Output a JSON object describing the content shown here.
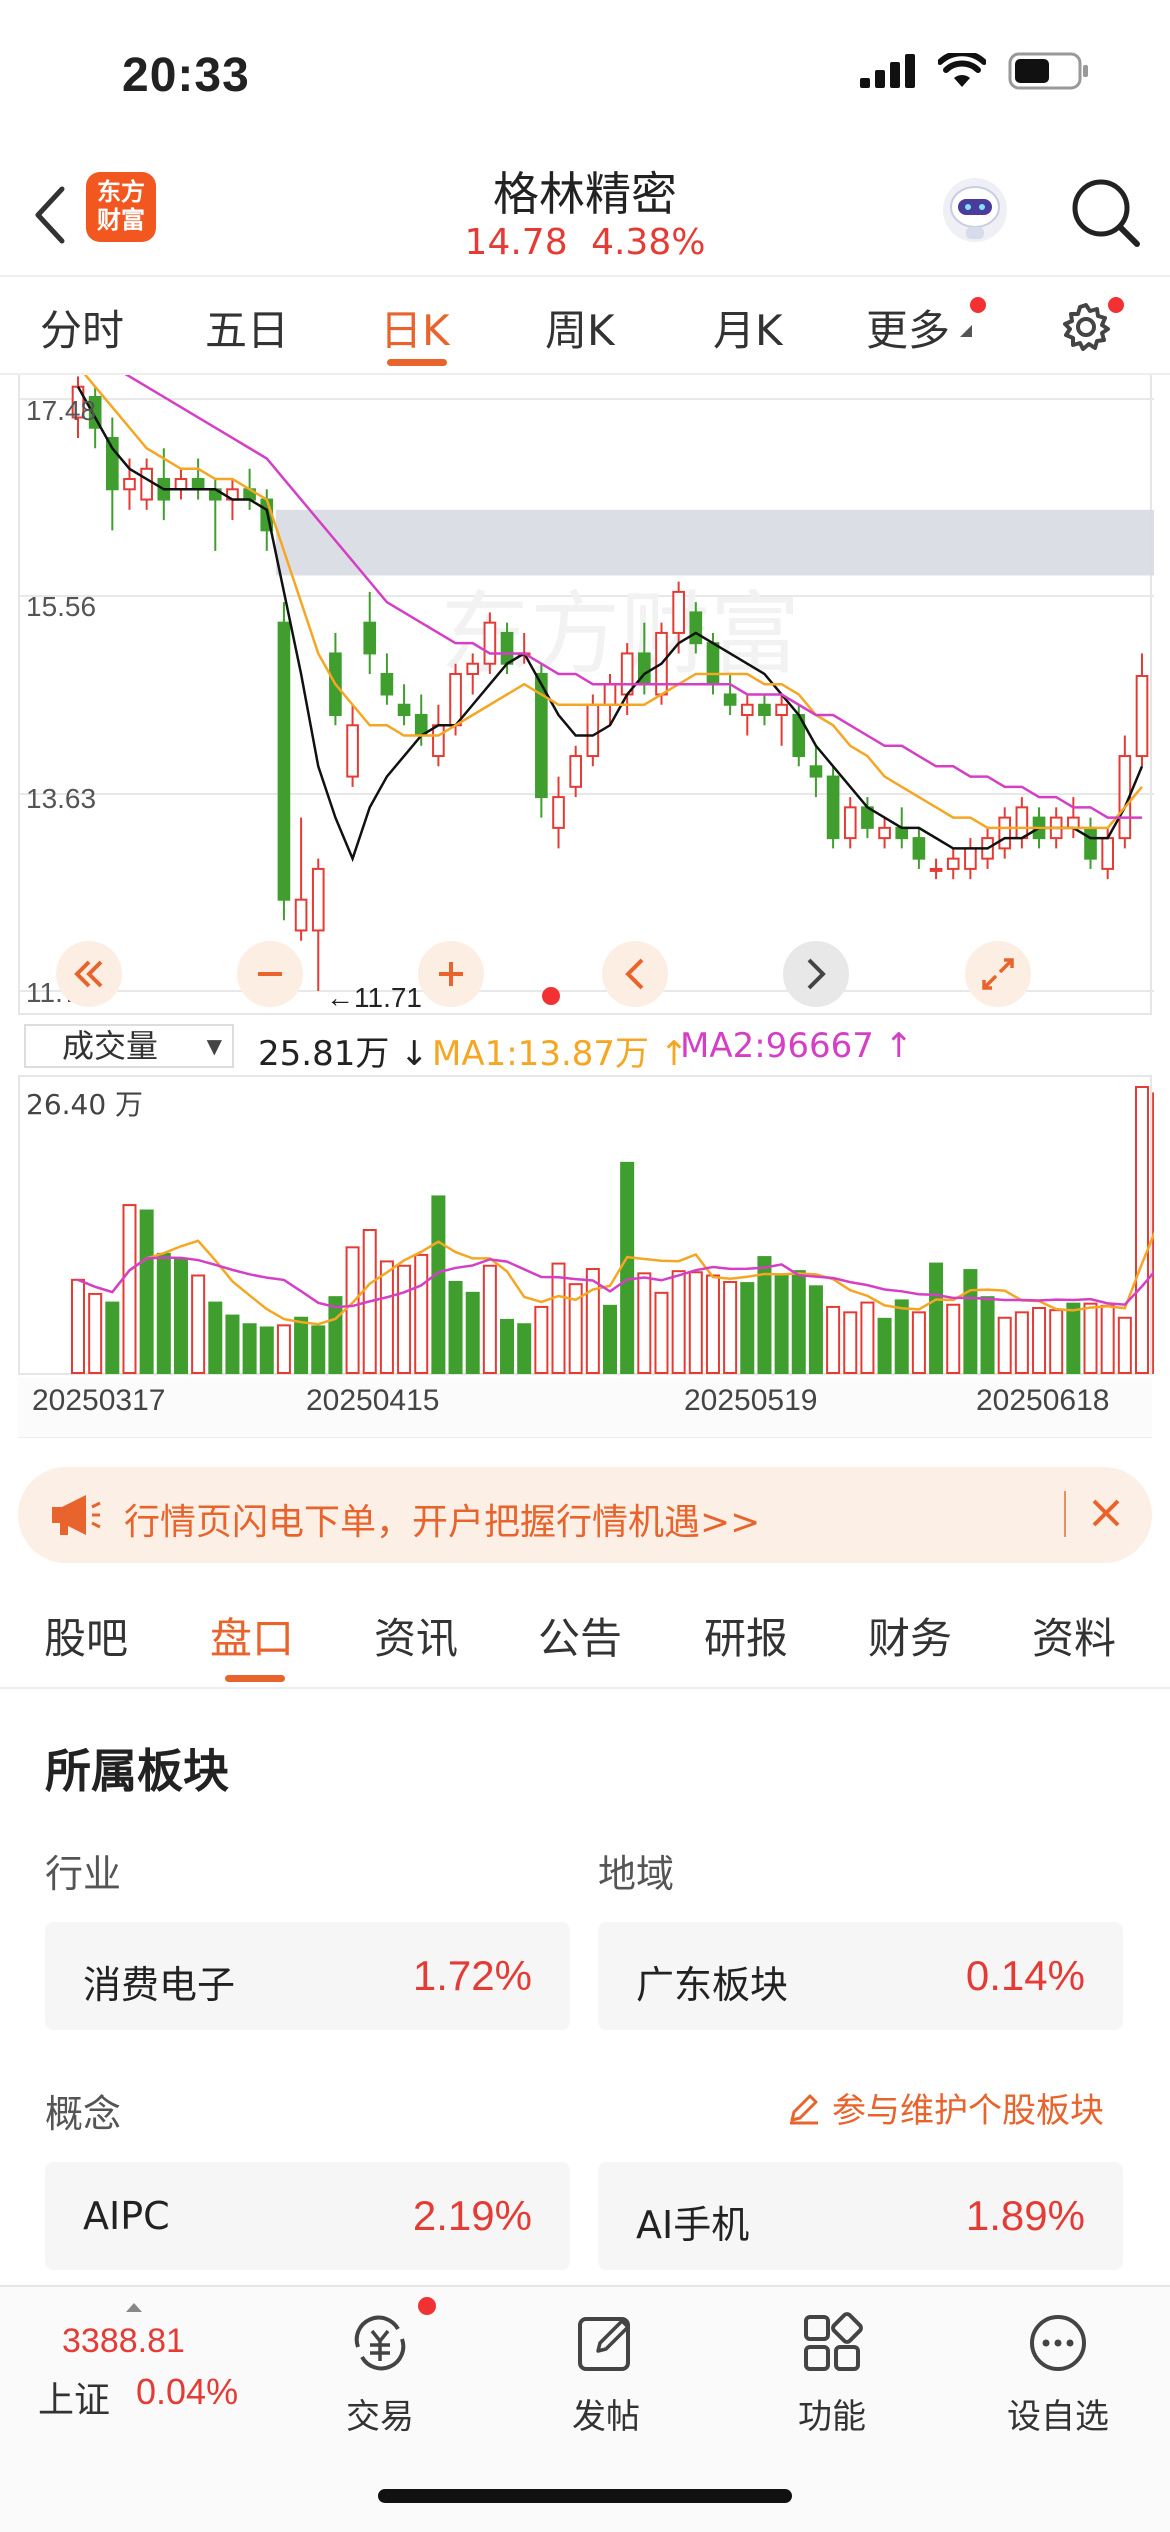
{
  "status_bar": {
    "time": "20:33"
  },
  "header": {
    "brand_logo_text": "东方\n财富",
    "title": "格林精密",
    "price": "14.78",
    "change_pct": "4.38%"
  },
  "period_tabs": [
    {
      "label": "分时"
    },
    {
      "label": "五日"
    },
    {
      "label": "日K"
    },
    {
      "label": "周K"
    },
    {
      "label": "月K"
    },
    {
      "label": "更多"
    }
  ],
  "active_period": "日K",
  "kline": {
    "price_axis": [
      "17.48",
      "15.56",
      "13.63",
      "11.71"
    ],
    "low_marker": "←11.71",
    "watermark": "东方财富"
  },
  "volume": {
    "selector": "成交量",
    "current": "25.81万 ↓",
    "ma1": "MA1:13.87万 ↑",
    "ma2": "MA2:96667 ↑",
    "max_label": "26.40 万",
    "dates": [
      "20250317",
      "20250415",
      "20250519",
      "20250618"
    ]
  },
  "chart_data": {
    "type": "candlestick",
    "title": "",
    "ylim": [
      11.71,
      17.48
    ],
    "y_ticks": [
      17.48,
      15.56,
      13.63,
      11.71
    ],
    "x_ticks": [
      "20250317",
      "20250415",
      "20250519",
      "20250618"
    ],
    "candles": [
      {
        "o": 17.3,
        "h": 17.7,
        "l": 17.1,
        "c": 17.6
      },
      {
        "o": 17.5,
        "h": 17.6,
        "l": 17.0,
        "c": 17.2
      },
      {
        "o": 17.1,
        "h": 17.3,
        "l": 16.2,
        "c": 16.6
      },
      {
        "o": 16.6,
        "h": 16.9,
        "l": 16.4,
        "c": 16.7
      },
      {
        "o": 16.5,
        "h": 16.9,
        "l": 16.4,
        "c": 16.8
      },
      {
        "o": 16.7,
        "h": 17.0,
        "l": 16.3,
        "c": 16.5
      },
      {
        "o": 16.6,
        "h": 16.8,
        "l": 16.5,
        "c": 16.7
      },
      {
        "o": 16.7,
        "h": 16.9,
        "l": 16.5,
        "c": 16.6
      },
      {
        "o": 16.6,
        "h": 16.7,
        "l": 16.0,
        "c": 16.5
      },
      {
        "o": 16.5,
        "h": 16.7,
        "l": 16.3,
        "c": 16.6
      },
      {
        "o": 16.6,
        "h": 16.8,
        "l": 16.4,
        "c": 16.5
      },
      {
        "o": 16.5,
        "h": 16.6,
        "l": 16.0,
        "c": 16.2
      },
      {
        "o": 15.3,
        "h": 15.5,
        "l": 12.4,
        "c": 12.6
      },
      {
        "o": 12.3,
        "h": 13.4,
        "l": 12.2,
        "c": 12.6
      },
      {
        "o": 12.3,
        "h": 13.0,
        "l": 11.71,
        "c": 12.9
      },
      {
        "o": 15.0,
        "h": 15.2,
        "l": 14.3,
        "c": 14.4
      },
      {
        "o": 13.8,
        "h": 14.5,
        "l": 13.7,
        "c": 14.3
      },
      {
        "o": 15.3,
        "h": 15.6,
        "l": 14.8,
        "c": 15.0
      },
      {
        "o": 14.8,
        "h": 15.0,
        "l": 14.5,
        "c": 14.6
      },
      {
        "o": 14.5,
        "h": 14.7,
        "l": 14.3,
        "c": 14.4
      },
      {
        "o": 14.4,
        "h": 14.6,
        "l": 14.1,
        "c": 14.2
      },
      {
        "o": 14.0,
        "h": 14.5,
        "l": 13.9,
        "c": 14.3
      },
      {
        "o": 14.3,
        "h": 14.9,
        "l": 14.2,
        "c": 14.8
      },
      {
        "o": 14.8,
        "h": 15.0,
        "l": 14.6,
        "c": 14.9
      },
      {
        "o": 14.9,
        "h": 15.4,
        "l": 14.8,
        "c": 15.3
      },
      {
        "o": 15.2,
        "h": 15.3,
        "l": 14.8,
        "c": 14.9
      },
      {
        "o": 15.0,
        "h": 15.2,
        "l": 14.9,
        "c": 15.0
      },
      {
        "o": 14.8,
        "h": 14.9,
        "l": 13.4,
        "c": 13.6
      },
      {
        "o": 13.3,
        "h": 13.8,
        "l": 13.1,
        "c": 13.6
      },
      {
        "o": 13.7,
        "h": 14.1,
        "l": 13.6,
        "c": 14.0
      },
      {
        "o": 14.0,
        "h": 14.6,
        "l": 13.9,
        "c": 14.5
      },
      {
        "o": 14.5,
        "h": 14.8,
        "l": 14.3,
        "c": 14.7
      },
      {
        "o": 14.6,
        "h": 15.1,
        "l": 14.4,
        "c": 15.0
      },
      {
        "o": 15.0,
        "h": 15.3,
        "l": 14.6,
        "c": 14.7
      },
      {
        "o": 14.6,
        "h": 15.3,
        "l": 14.5,
        "c": 15.2
      },
      {
        "o": 15.2,
        "h": 15.7,
        "l": 15.0,
        "c": 15.6
      },
      {
        "o": 15.4,
        "h": 15.5,
        "l": 15.0,
        "c": 15.1
      },
      {
        "o": 15.1,
        "h": 15.2,
        "l": 14.6,
        "c": 14.7
      },
      {
        "o": 14.6,
        "h": 14.8,
        "l": 14.4,
        "c": 14.5
      },
      {
        "o": 14.4,
        "h": 14.6,
        "l": 14.2,
        "c": 14.5
      },
      {
        "o": 14.5,
        "h": 14.6,
        "l": 14.3,
        "c": 14.4
      },
      {
        "o": 14.4,
        "h": 14.6,
        "l": 14.1,
        "c": 14.5
      },
      {
        "o": 14.4,
        "h": 14.5,
        "l": 13.9,
        "c": 14.0
      },
      {
        "o": 13.9,
        "h": 14.1,
        "l": 13.6,
        "c": 13.8
      },
      {
        "o": 13.8,
        "h": 13.9,
        "l": 13.1,
        "c": 13.2
      },
      {
        "o": 13.2,
        "h": 13.6,
        "l": 13.1,
        "c": 13.5
      },
      {
        "o": 13.5,
        "h": 13.6,
        "l": 13.2,
        "c": 13.3
      },
      {
        "o": 13.2,
        "h": 13.4,
        "l": 13.1,
        "c": 13.3
      },
      {
        "o": 13.3,
        "h": 13.5,
        "l": 13.1,
        "c": 13.2
      },
      {
        "o": 13.2,
        "h": 13.3,
        "l": 12.9,
        "c": 13.0
      },
      {
        "o": 12.9,
        "h": 13.0,
        "l": 12.8,
        "c": 12.9
      },
      {
        "o": 12.9,
        "h": 13.1,
        "l": 12.8,
        "c": 13.0
      },
      {
        "o": 12.9,
        "h": 13.2,
        "l": 12.8,
        "c": 13.1
      },
      {
        "o": 13.0,
        "h": 13.3,
        "l": 12.9,
        "c": 13.2
      },
      {
        "o": 13.1,
        "h": 13.5,
        "l": 13.0,
        "c": 13.4
      },
      {
        "o": 13.2,
        "h": 13.6,
        "l": 13.1,
        "c": 13.5
      },
      {
        "o": 13.4,
        "h": 13.5,
        "l": 13.1,
        "c": 13.2
      },
      {
        "o": 13.2,
        "h": 13.5,
        "l": 13.1,
        "c": 13.4
      },
      {
        "o": 13.3,
        "h": 13.6,
        "l": 13.2,
        "c": 13.4
      },
      {
        "o": 13.3,
        "h": 13.4,
        "l": 12.9,
        "c": 13.0
      },
      {
        "o": 12.9,
        "h": 13.3,
        "l": 12.8,
        "c": 13.2
      },
      {
        "o": 13.2,
        "h": 14.2,
        "l": 13.1,
        "c": 14.0
      },
      {
        "o": 14.0,
        "h": 15.0,
        "l": 13.9,
        "c": 14.78
      }
    ],
    "ma_lines": [
      {
        "color": "#111111",
        "values": [
          17.6,
          17.3,
          17.0,
          16.8,
          16.7,
          16.6,
          16.6,
          16.6,
          16.6,
          16.5,
          16.5,
          16.4,
          15.6,
          14.8,
          13.9,
          13.4,
          13.0,
          13.5,
          13.8,
          14.0,
          14.2,
          14.3,
          14.3,
          14.5,
          14.7,
          14.9,
          15.0,
          14.7,
          14.4,
          14.2,
          14.2,
          14.3,
          14.6,
          14.8,
          14.9,
          15.1,
          15.2,
          15.1,
          15.0,
          14.9,
          14.8,
          14.6,
          14.4,
          14.1,
          13.9,
          13.7,
          13.5,
          13.4,
          13.3,
          13.3,
          13.2,
          13.1,
          13.1,
          13.1,
          13.2,
          13.2,
          13.3,
          13.3,
          13.3,
          13.2,
          13.2,
          13.5,
          13.9
        ]
      },
      {
        "color": "#f5a623",
        "values": [
          17.8,
          17.6,
          17.4,
          17.2,
          17.0,
          16.9,
          16.8,
          16.8,
          16.7,
          16.7,
          16.6,
          16.5,
          16.0,
          15.5,
          15.0,
          14.7,
          14.5,
          14.3,
          14.3,
          14.2,
          14.2,
          14.2,
          14.3,
          14.4,
          14.5,
          14.6,
          14.7,
          14.6,
          14.5,
          14.5,
          14.5,
          14.5,
          14.5,
          14.5,
          14.6,
          14.7,
          14.8,
          14.8,
          14.8,
          14.8,
          14.7,
          14.7,
          14.6,
          14.4,
          14.3,
          14.1,
          14.0,
          13.8,
          13.7,
          13.6,
          13.5,
          13.4,
          13.4,
          13.3,
          13.3,
          13.3,
          13.3,
          13.3,
          13.3,
          13.3,
          13.3,
          13.5,
          13.7
        ]
      },
      {
        "color": "#d43fc6",
        "values": [
          18.0,
          17.9,
          17.8,
          17.7,
          17.6,
          17.5,
          17.4,
          17.3,
          17.2,
          17.1,
          17.0,
          16.9,
          16.7,
          16.5,
          16.3,
          16.1,
          15.9,
          15.7,
          15.5,
          15.4,
          15.3,
          15.2,
          15.1,
          15.1,
          15.0,
          15.0,
          15.0,
          14.9,
          14.8,
          14.8,
          14.7,
          14.7,
          14.7,
          14.7,
          14.7,
          14.7,
          14.7,
          14.7,
          14.7,
          14.6,
          14.6,
          14.6,
          14.5,
          14.4,
          14.4,
          14.3,
          14.2,
          14.1,
          14.1,
          14.0,
          13.9,
          13.9,
          13.8,
          13.8,
          13.7,
          13.7,
          13.6,
          13.6,
          13.5,
          13.5,
          13.4,
          13.4,
          13.4
        ]
      }
    ],
    "volume_max": 26.4,
    "volume_values": [
      8.6,
      7.3,
      6.5,
      15.5,
      15.0,
      11.0,
      10.5,
      9.0,
      6.5,
      5.3,
      4.5,
      4.2,
      4.4,
      5.1,
      4.3,
      7.0,
      11.6,
      13.2,
      10.3,
      9.9,
      10.9,
      16.3,
      8.4,
      7.4,
      9.9,
      4.9,
      4.5,
      6.1,
      10.1,
      8.2,
      9.6,
      6.2,
      19.4,
      9.2,
      7.4,
      9.4,
      9.3,
      9.0,
      8.4,
      8.3,
      10.7,
      9.1,
      9.4,
      8.0,
      6.1,
      5.6,
      6.5,
      5.0,
      6.7,
      5.6,
      10.1,
      6.3,
      9.5,
      7.0,
      5.1,
      5.6,
      6.0,
      5.8,
      6.4,
      6.4,
      6.2,
      5.1,
      26.4,
      25.81
    ],
    "volume_up": [
      1,
      1,
      0,
      1,
      0,
      0,
      0,
      1,
      0,
      0,
      0,
      0,
      1,
      0,
      0,
      0,
      1,
      1,
      1,
      1,
      1,
      0,
      0,
      0,
      1,
      0,
      0,
      1,
      1,
      1,
      1,
      0,
      0,
      1,
      1,
      1,
      1,
      1,
      1,
      0,
      0,
      0,
      0,
      0,
      1,
      1,
      1,
      0,
      0,
      1,
      0,
      1,
      0,
      0,
      1,
      1,
      1,
      1,
      0,
      1,
      1,
      1,
      1,
      1
    ]
  },
  "promo": {
    "text": "行情页闪电下单，开户把握行情机遇>>"
  },
  "section_tabs": [
    {
      "label": "股吧"
    },
    {
      "label": "盘口"
    },
    {
      "label": "资讯"
    },
    {
      "label": "公告"
    },
    {
      "label": "研报"
    },
    {
      "label": "财务"
    },
    {
      "label": "资料"
    }
  ],
  "sectors": {
    "title": "所属板块",
    "industry_label": "行业",
    "region_label": "地域",
    "concept_label": "概念",
    "maintain_link": "参与维护个股板块",
    "cards": [
      {
        "name": "消费电子",
        "pct": "1.72%"
      },
      {
        "name": "广东板块",
        "pct": "0.14%"
      },
      {
        "name": "AIPC",
        "pct": "2.19%"
      },
      {
        "name": "AI手机",
        "pct": "1.89%"
      }
    ]
  },
  "bottom_bar": {
    "index_value": "3388.81",
    "index_name": "上证",
    "index_pct": "0.04%",
    "items": [
      {
        "label": "交易"
      },
      {
        "label": "发帖"
      },
      {
        "label": "功能"
      },
      {
        "label": "设自选"
      }
    ]
  },
  "colors": {
    "up": "#e53b35",
    "down": "#3f9e2e",
    "accent": "#e8642c"
  }
}
